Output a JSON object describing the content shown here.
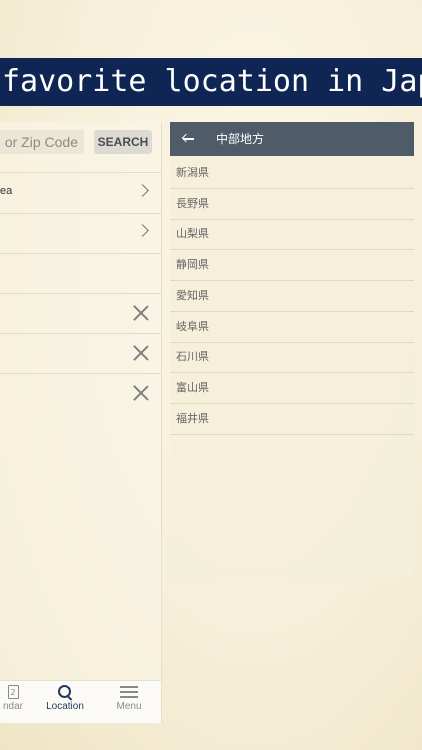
{
  "banner": {
    "text": "favorite location in Japan"
  },
  "search": {
    "placeholder_visible": "or Zip Code",
    "button_label": "SEARCH"
  },
  "left_list": {
    "rows": [
      {
        "label": "ea",
        "trailing": "chevron-right-icon"
      },
      {
        "label": "",
        "trailing": "chevron-right-icon"
      },
      {
        "label": "",
        "trailing": ""
      },
      {
        "label": "",
        "trailing": "close-icon"
      },
      {
        "label": "",
        "trailing": "close-icon"
      },
      {
        "label": "",
        "trailing": "close-icon"
      }
    ]
  },
  "bottom_nav": {
    "items": [
      {
        "label": "ndar",
        "icon": "calendar-icon",
        "icon_text": "2"
      },
      {
        "label": "Location",
        "icon": "search-icon"
      },
      {
        "label": "Menu",
        "icon": "menu-icon"
      }
    ],
    "active_color": "#1f3b5c"
  },
  "region_panel": {
    "title": "中部地方",
    "header_color": "#4f5b68",
    "prefectures": [
      "新潟県",
      "長野県",
      "山梨県",
      "静岡県",
      "愛知県",
      "岐阜県",
      "石川県",
      "富山県",
      "福井県"
    ]
  }
}
